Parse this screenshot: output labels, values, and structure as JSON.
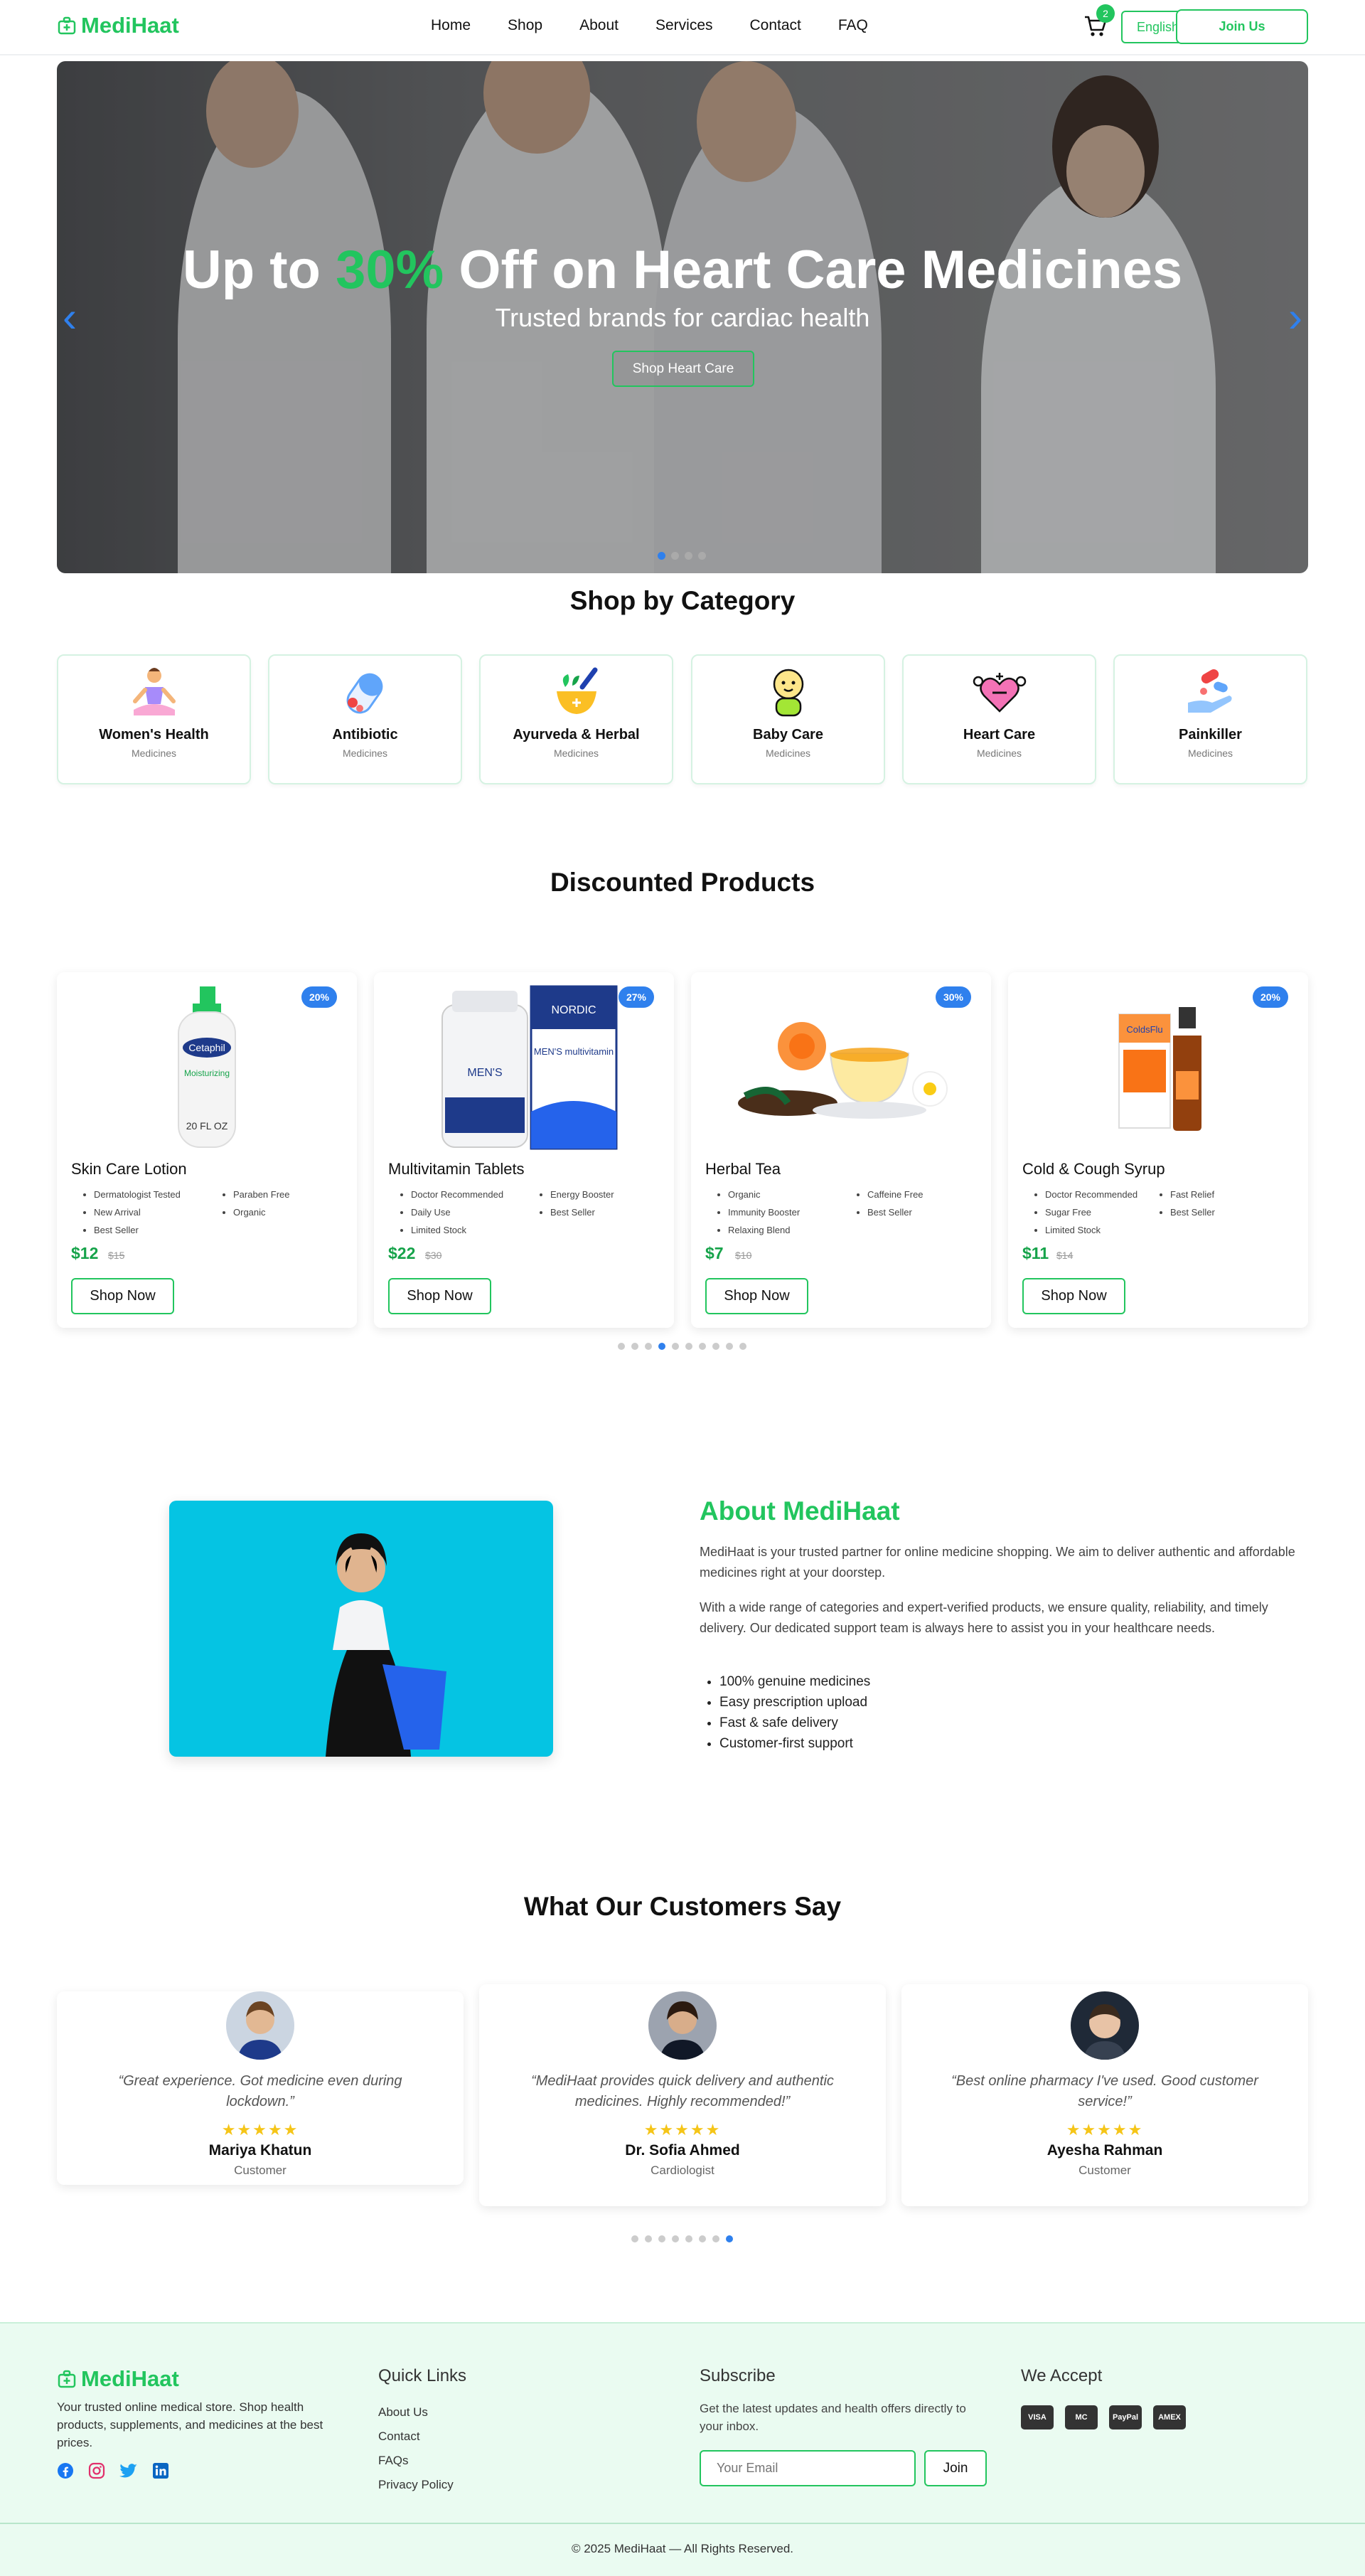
{
  "brand": {
    "name": "MediHaat"
  },
  "nav": {
    "items": [
      "Home",
      "Shop",
      "About",
      "Services",
      "Contact",
      "FAQ"
    ],
    "cart_count": "2",
    "language": "English",
    "join_label": "Join Us"
  },
  "hero": {
    "title_pre": "Up to ",
    "title_highlight": "30%",
    "title_post": " Off on Heart Care Medicines",
    "subtitle": "Trusted brands for cardiac health",
    "button": "Shop Heart Care"
  },
  "categories": {
    "title": "Shop by Category",
    "items": [
      {
        "name": "Women's Health",
        "sub": "Medicines"
      },
      {
        "name": "Antibiotic",
        "sub": "Medicines"
      },
      {
        "name": "Ayurveda & Herbal",
        "sub": "Medicines"
      },
      {
        "name": "Baby Care",
        "sub": "Medicines"
      },
      {
        "name": "Heart Care",
        "sub": "Medicines"
      },
      {
        "name": "Painkiller",
        "sub": "Medicines"
      }
    ]
  },
  "products": {
    "title": "Discounted Products",
    "items": [
      {
        "name": "Skin Care Lotion",
        "discount": "20%",
        "features": [
          "Dermatologist Tested",
          "Paraben Free",
          "New Arrival",
          "Organic",
          "Best Seller"
        ],
        "price": "$12",
        "old": "$15",
        "button": "Shop Now",
        "label": "Cetaphil",
        "size": "20 FL OZ"
      },
      {
        "name": "Multivitamin Tablets",
        "discount": "27%",
        "features": [
          "Doctor Recommended",
          "Energy Booster",
          "Daily Use",
          "Best Seller",
          "Limited Stock"
        ],
        "price": "$22",
        "old": "$30",
        "button": "Shop Now",
        "label": "NORDIC",
        "label2": "MEN'S multivitamin"
      },
      {
        "name": "Herbal Tea",
        "discount": "30%",
        "features": [
          "Organic",
          "Caffeine Free",
          "Immunity Booster",
          "Best Seller",
          "Relaxing Blend"
        ],
        "price": "$7",
        "old": "$10",
        "button": "Shop Now"
      },
      {
        "name": "Cold & Cough Syrup",
        "discount": "20%",
        "features": [
          "Doctor Recommended",
          "Fast Relief",
          "Sugar Free",
          "Best Seller",
          "Limited Stock"
        ],
        "price": "$11",
        "old": "$14",
        "button": "Shop Now",
        "label": "ColdsFlu"
      }
    ]
  },
  "about": {
    "title": "About MediHaat",
    "p1": "MediHaat is your trusted partner for online medicine shopping. We aim to deliver authentic and affordable medicines right at your doorstep.",
    "p2": "With a wide range of categories and expert-verified products, we ensure quality, reliability, and timely delivery. Our dedicated support team is always here to assist you in your healthcare needs.",
    "list": [
      "100% genuine medicines",
      "Easy prescription upload",
      "Fast & safe delivery",
      "Customer-first support"
    ]
  },
  "testimonials": {
    "title": "What Our Customers Say",
    "items": [
      {
        "quote": "“Great experience. Got medicine even during lockdown.”",
        "stars": "★★★★★",
        "name": "Mariya Khatun",
        "role": "Customer"
      },
      {
        "quote": "“MediHaat provides quick delivery and authentic medicines. Highly recommended!”",
        "stars": "★★★★★",
        "name": "Dr. Sofia Ahmed",
        "role": "Cardiologist"
      },
      {
        "quote": "“Best online pharmacy I've used. Good customer service!”",
        "stars": "★★★★★",
        "name": "Ayesha Rahman",
        "role": "Customer"
      }
    ]
  },
  "footer": {
    "brand": "MediHaat",
    "desc": "Your trusted online medical store. Shop health products, supplements, and medicines at the best prices.",
    "quick_title": "Quick Links",
    "links": [
      "About Us",
      "Contact",
      "FAQs",
      "Privacy Policy"
    ],
    "sub_title": "Subscribe",
    "sub_text": "Get the latest updates and health offers directly to your inbox.",
    "email_placeholder": "Your Email",
    "join": "Join",
    "accept_title": "We Accept",
    "payments": [
      "VISA",
      "MC",
      "PayPal",
      "AMEX"
    ],
    "copyright": "© 2025 MediHaat — All Rights Reserved."
  },
  "colors": {
    "accent": "#22c55e",
    "blue": "#2f80ed",
    "star": "#f5c518"
  },
  "icons": {
    "logo": "medical-bag-icon",
    "cart": "cart-icon",
    "social": [
      "facebook-icon",
      "instagram-icon",
      "twitter-icon",
      "linkedin-icon"
    ]
  }
}
